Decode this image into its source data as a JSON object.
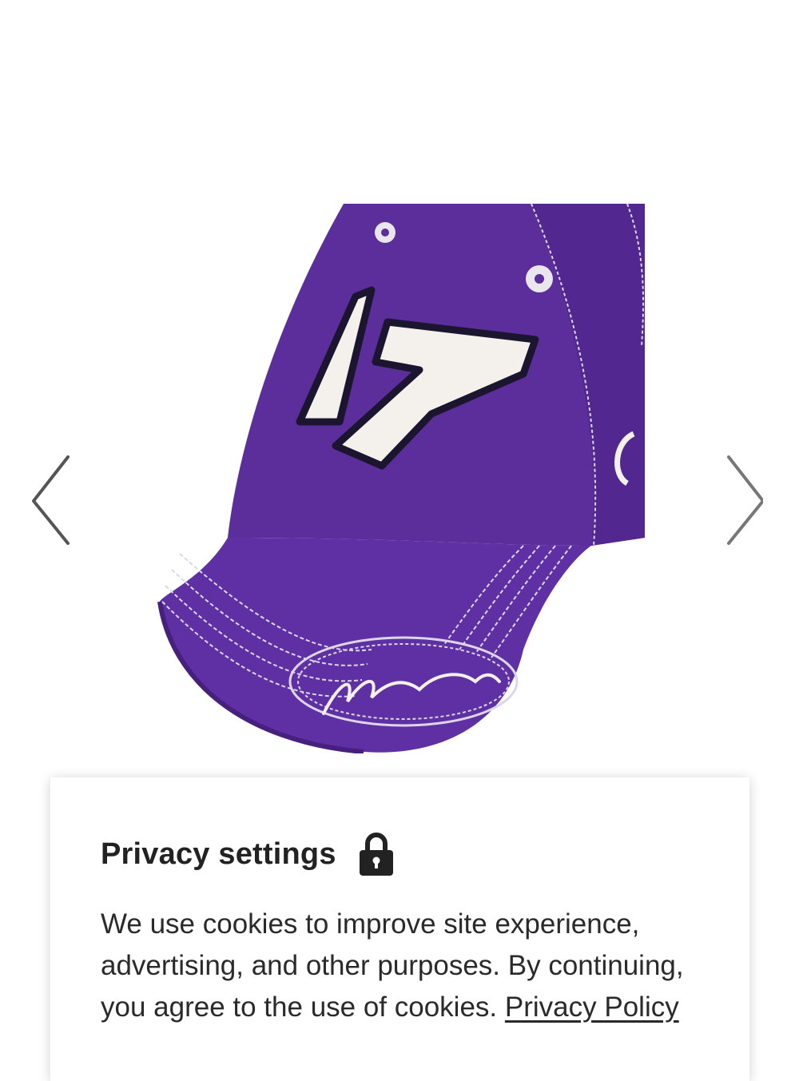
{
  "gallery": {
    "prev_icon": "chevron-left-icon",
    "next_icon": "chevron-right-icon",
    "image": {
      "subject": "purple baseball cap",
      "front_number": "17",
      "colors": {
        "cap": "#5a2d9a",
        "cap_shade": "#47207e",
        "number_fill": "#f4f1ec",
        "number_outline": "#1c1530",
        "stitching": "#ddd6ea"
      }
    }
  },
  "privacy": {
    "title": "Privacy settings",
    "title_icon": "lock-icon",
    "body_text": "We use cookies to improve site experience, advertising, and other purposes. By continuing, you agree to the use of cookies.",
    "link_text": "Privacy Policy"
  }
}
